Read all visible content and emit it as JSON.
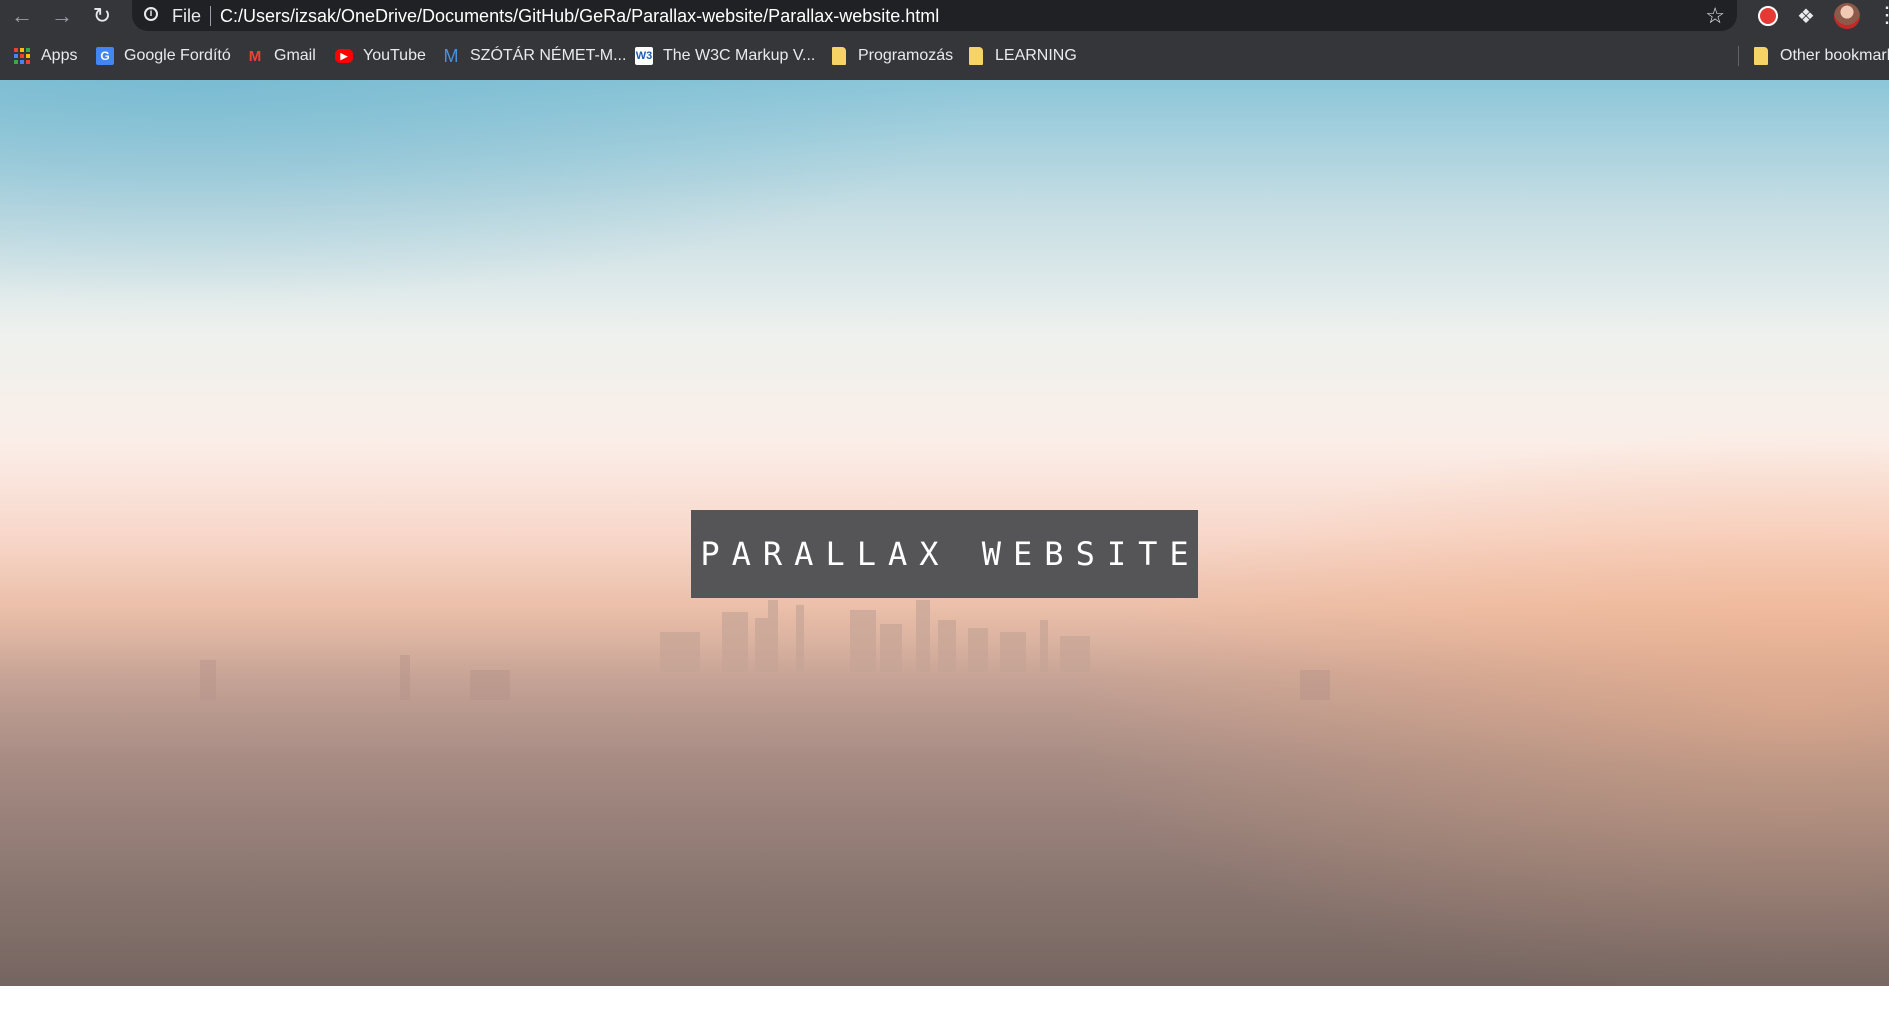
{
  "browser": {
    "back_icon": "arrow-left-icon",
    "forward_icon": "arrow-right-icon",
    "reload_icon": "reload-icon",
    "security_label": "File",
    "url": "C:/Users/izsak/OneDrive/Documents/GitHub/GeRa/Parallax-website/Parallax-website.html"
  },
  "bookmarks": {
    "items": [
      {
        "label": "Apps",
        "icon": "apps-grid-icon"
      },
      {
        "label": "Google Fordító",
        "icon": "google-translate-icon"
      },
      {
        "label": "Gmail",
        "icon": "gmail-icon"
      },
      {
        "label": "YouTube",
        "icon": "youtube-icon"
      },
      {
        "label": "SZÓTÁR NÉMET-M...",
        "icon": "m-letter-icon"
      },
      {
        "label": "The W3C Markup V...",
        "icon": "w3c-icon"
      },
      {
        "label": "Programozás",
        "icon": "folder-icon"
      },
      {
        "label": "LEARNING",
        "icon": "folder-icon"
      }
    ],
    "other": "Other bookmarks"
  },
  "page": {
    "title": "PARALLAX WEBSITE"
  },
  "colors": {
    "browser_chrome": "#35363a",
    "omnibox": "#202124",
    "title_box": "#555456",
    "title_text": "#ffffff"
  }
}
